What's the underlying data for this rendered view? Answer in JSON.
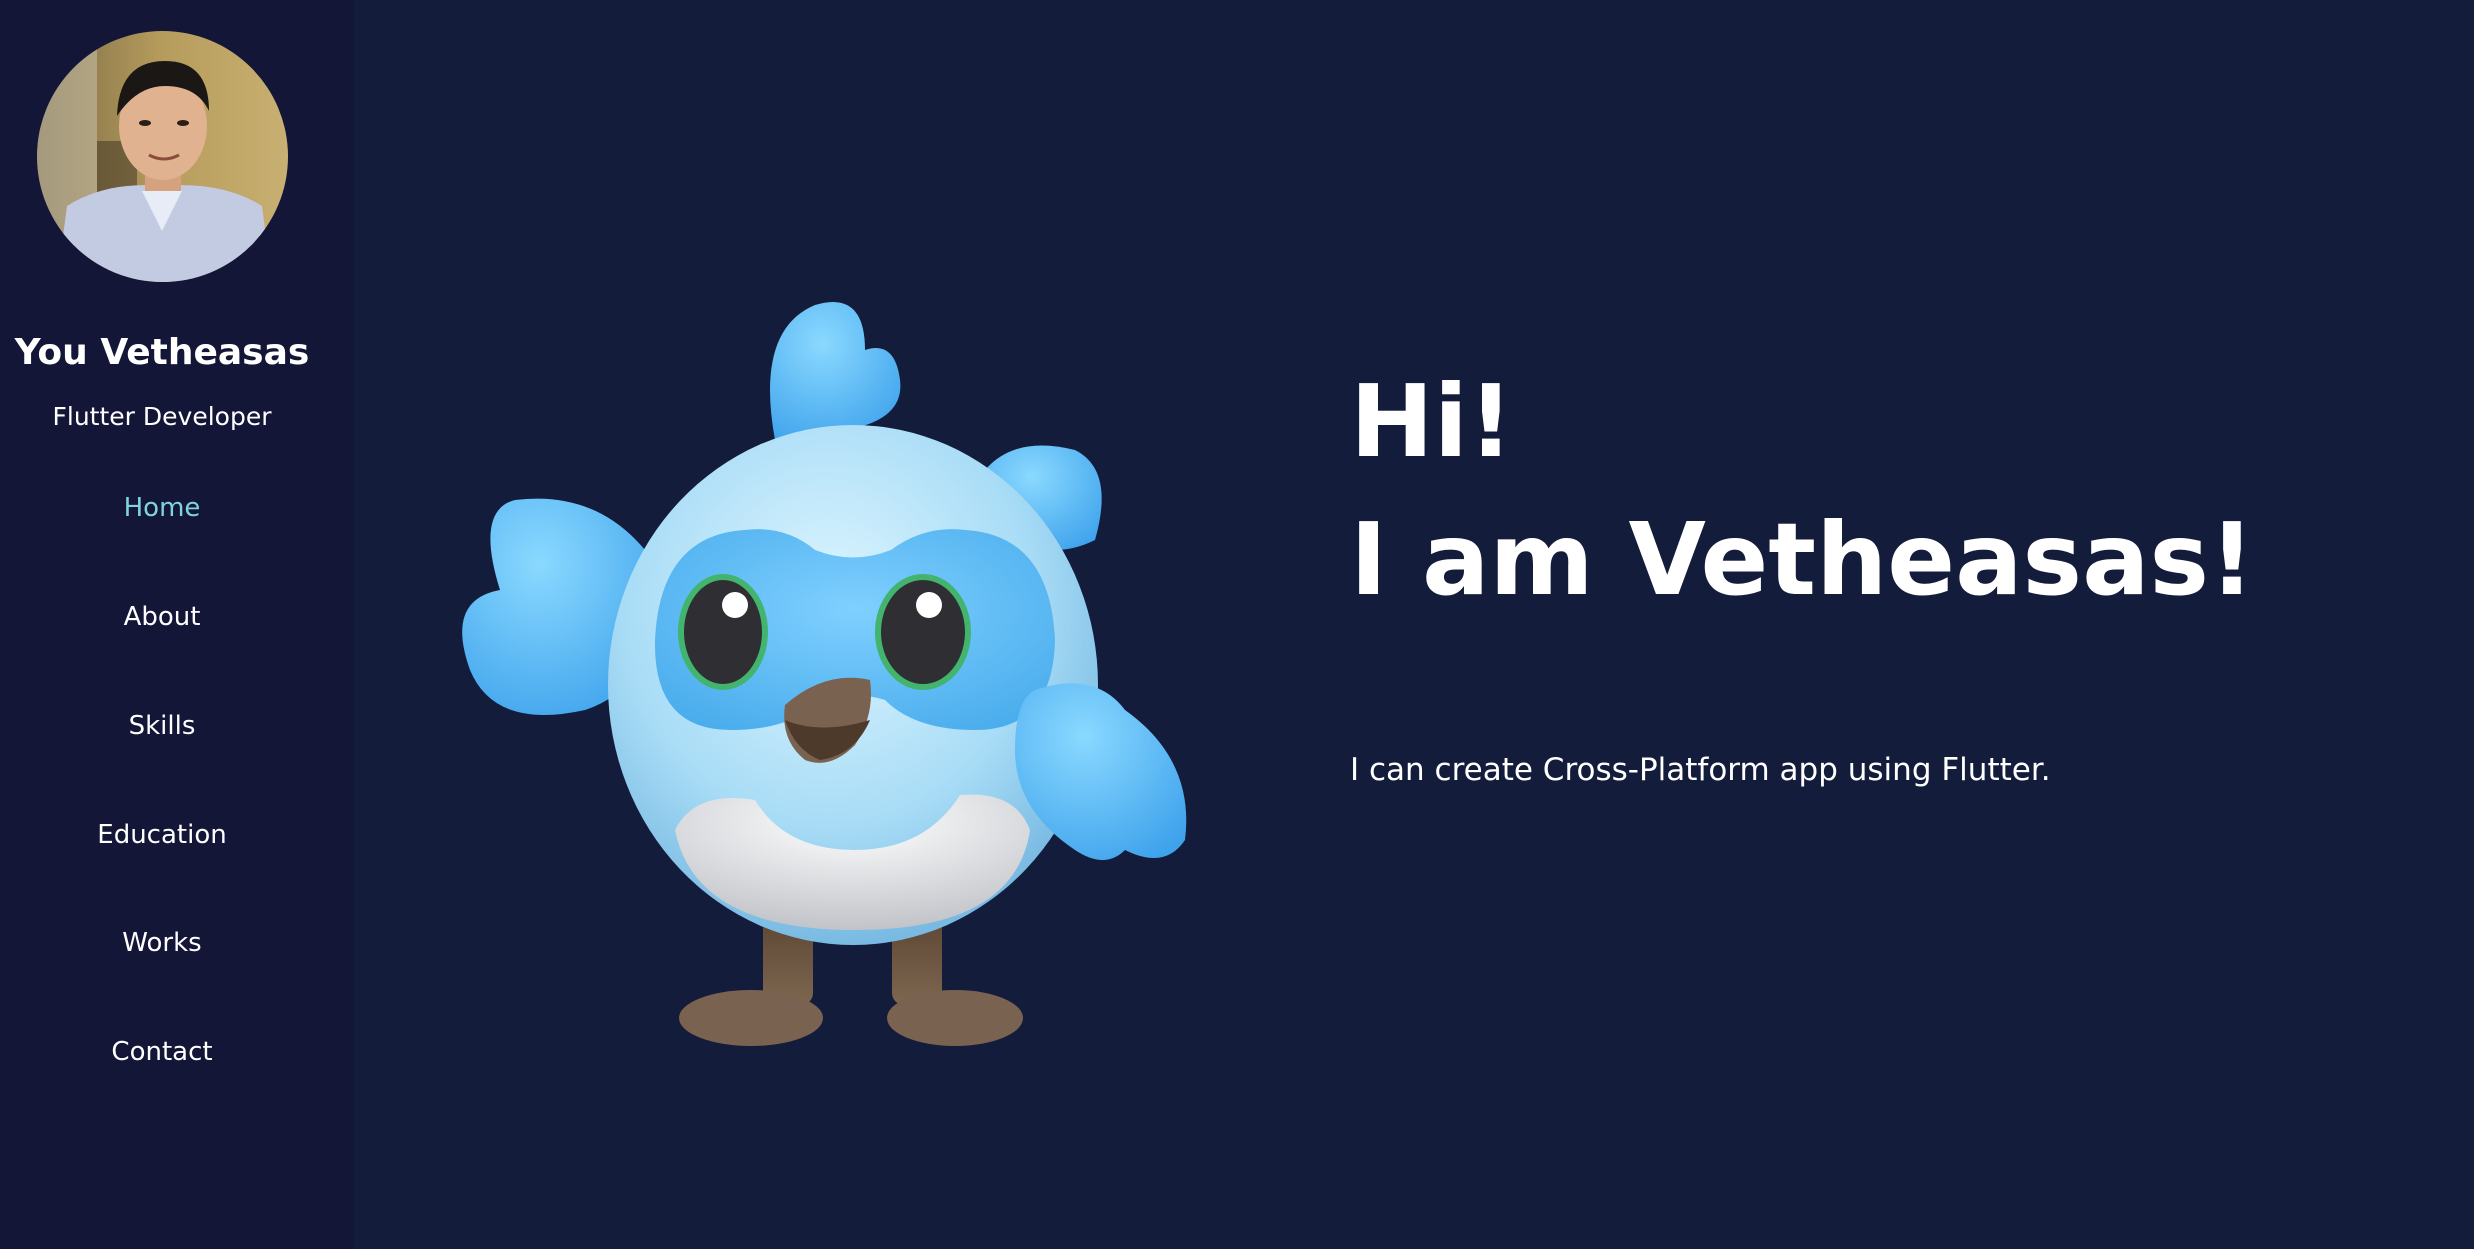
{
  "profile": {
    "name": "You Vetheasas",
    "role": "Flutter Developer"
  },
  "nav": {
    "items": [
      {
        "label": "Home",
        "active": true
      },
      {
        "label": "About",
        "active": false
      },
      {
        "label": "Skills",
        "active": false
      },
      {
        "label": "Education",
        "active": false
      },
      {
        "label": "Works",
        "active": false
      },
      {
        "label": "Contact",
        "active": false
      }
    ]
  },
  "hero": {
    "greeting_line1": "Hi!",
    "greeting_line2": "I am Vetheasas!",
    "tagline": "I can create Cross-Platform app using Flutter."
  },
  "colors": {
    "background": "#141c3c",
    "sidebar": "#141638",
    "nav_active": "#7fd3dc",
    "text": "#ffffff"
  }
}
